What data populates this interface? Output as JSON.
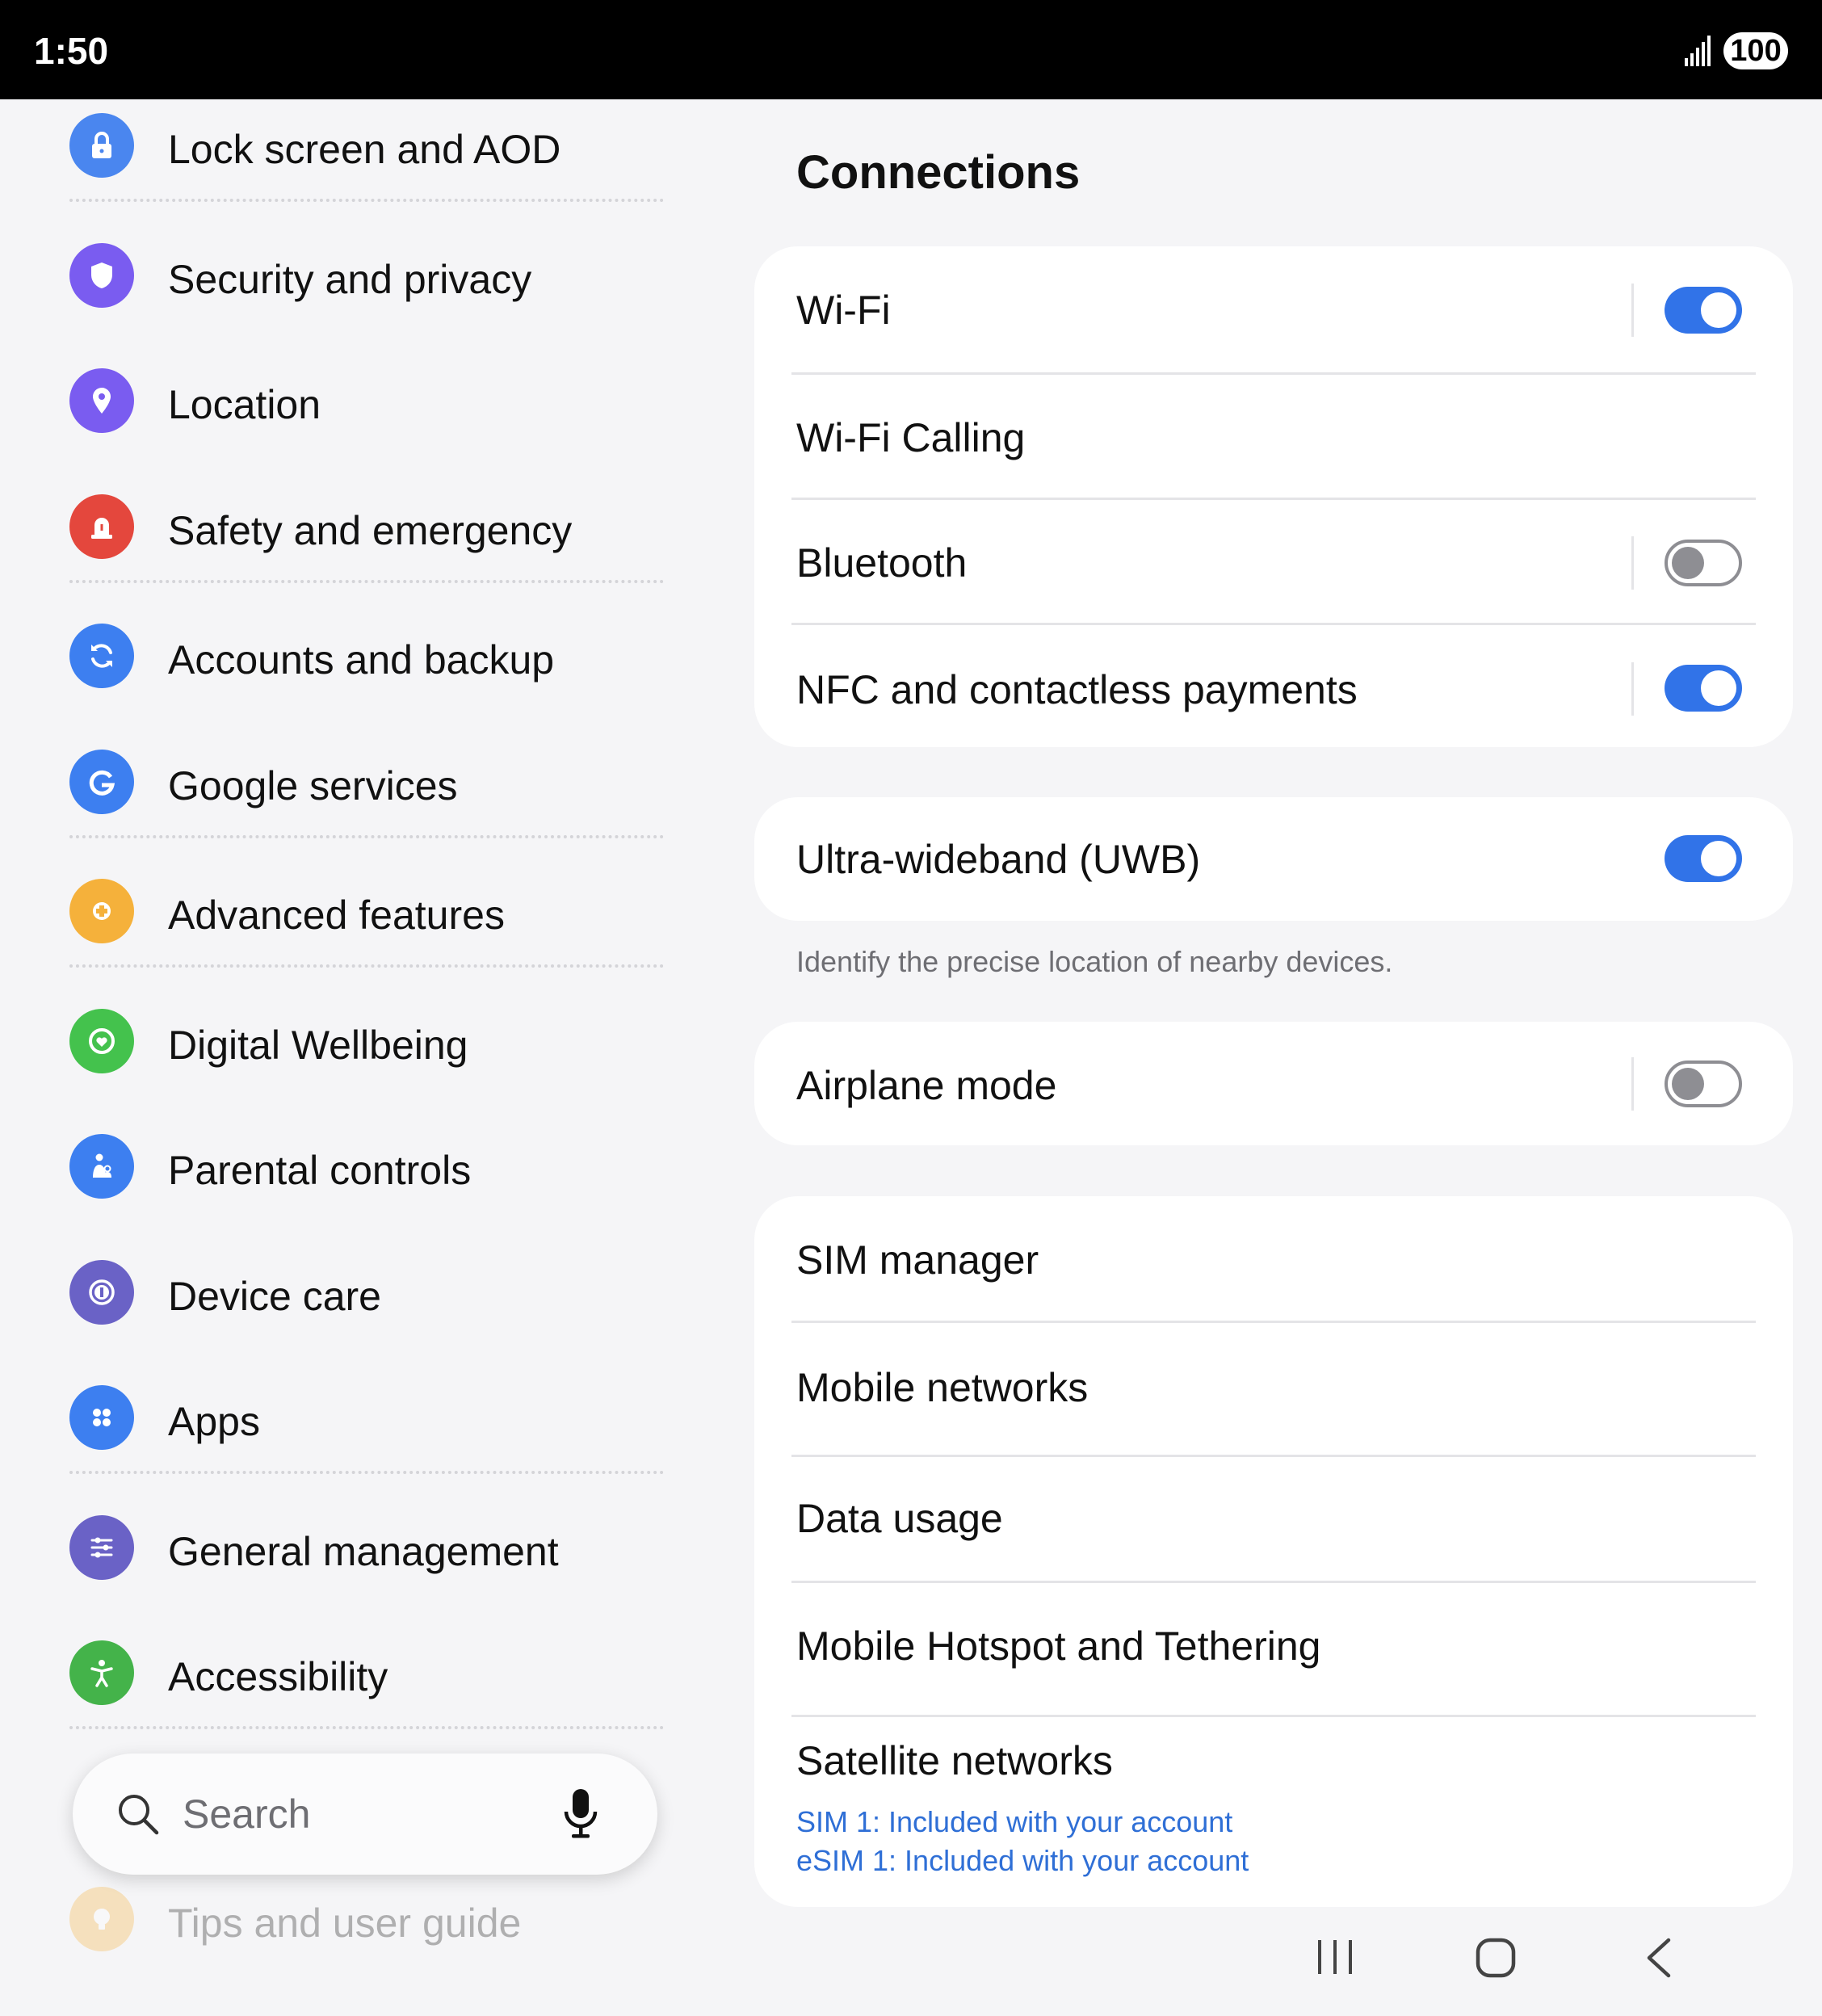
{
  "status_bar": {
    "time": "1:50",
    "battery": "100"
  },
  "sidebar": {
    "items": [
      {
        "label": "Lock screen and AOD",
        "icon": "lock-icon",
        "color": "#4a86ef"
      },
      {
        "label": "Security and privacy",
        "icon": "shield-icon",
        "color": "#7a5cf0"
      },
      {
        "label": "Location",
        "icon": "location-pin-icon",
        "color": "#7a5cf0"
      },
      {
        "label": "Safety and emergency",
        "icon": "emergency-siren-icon",
        "color": "#e4473d"
      },
      {
        "label": "Accounts and backup",
        "icon": "sync-icon",
        "color": "#3d7ff0"
      },
      {
        "label": "Google services",
        "icon": "google-g-icon",
        "color": "#3d7ff0"
      },
      {
        "label": "Advanced features",
        "icon": "puzzle-gear-icon",
        "color": "#f5b13b"
      },
      {
        "label": "Digital Wellbeing",
        "icon": "heart-ring-icon",
        "color": "#44c24d"
      },
      {
        "label": "Parental controls",
        "icon": "parent-child-icon",
        "color": "#3d7ff0"
      },
      {
        "label": "Device care",
        "icon": "device-care-icon",
        "color": "#6a62c6"
      },
      {
        "label": "Apps",
        "icon": "apps-grid-icon",
        "color": "#3d7ff0"
      },
      {
        "label": "General management",
        "icon": "sliders-icon",
        "color": "#6a62c6"
      },
      {
        "label": "Accessibility",
        "icon": "accessibility-person-icon",
        "color": "#44b34a"
      },
      {
        "label": "Tips and user guide",
        "icon": "lightbulb-icon",
        "color": "#f5b13b"
      }
    ],
    "search": {
      "placeholder": "Search"
    }
  },
  "main": {
    "title": "Connections",
    "group1": [
      {
        "label": "Wi-Fi",
        "toggle": "on"
      },
      {
        "label": "Wi-Fi Calling"
      },
      {
        "label": "Bluetooth",
        "toggle": "off"
      },
      {
        "label": "NFC and contactless payments",
        "toggle": "on"
      }
    ],
    "uwb": {
      "label": "Ultra-wideband (UWB)",
      "toggle": "on",
      "hint": "Identify the precise location of nearby devices."
    },
    "airplane": {
      "label": "Airplane mode",
      "toggle": "off"
    },
    "group3": [
      {
        "label": "SIM manager"
      },
      {
        "label": "Mobile networks"
      },
      {
        "label": "Data usage"
      },
      {
        "label": "Mobile Hotspot and Tethering"
      },
      {
        "label": "Satellite networks",
        "sub1": "SIM 1: Included with your account",
        "sub2": "eSIM 1: Included with your account"
      }
    ],
    "accent_color": "#3173e8"
  }
}
